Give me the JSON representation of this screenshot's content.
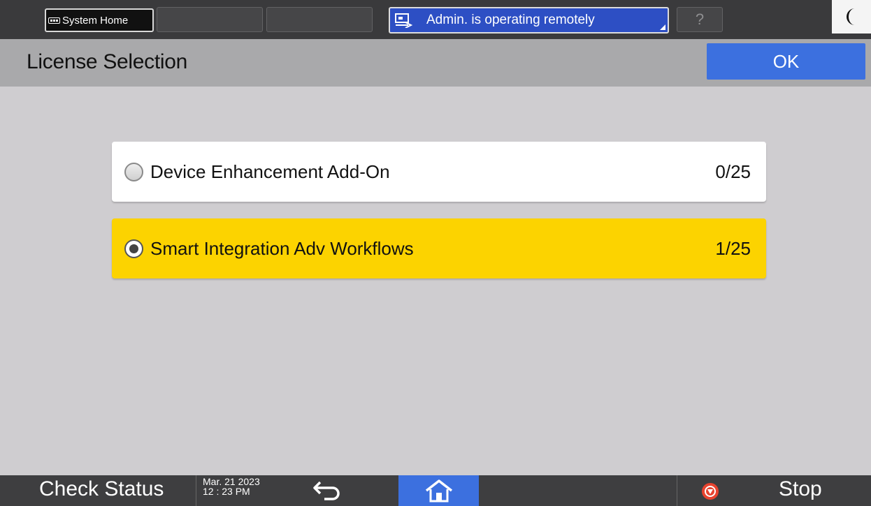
{
  "topbar": {
    "system_home_label": "System Home",
    "remote_status": "Admin. is operating remotely",
    "help_label": "?"
  },
  "header": {
    "title": "License Selection",
    "ok_label": "OK"
  },
  "options": [
    {
      "label": "Device Enhancement Add-On",
      "count": "0/25",
      "selected": false
    },
    {
      "label": "Smart Integration Adv Workflows",
      "count": "1/25",
      "selected": true
    }
  ],
  "bottombar": {
    "check_status_label": "Check Status",
    "date": "Mar. 21 2023",
    "time": "12 : 23 PM",
    "stop_label": "Stop"
  },
  "colors": {
    "accent": "#3c70df",
    "selected": "#fcd300",
    "remote": "#2d4fc4"
  },
  "icons": [
    "grid-icon",
    "remote-operation-icon",
    "moon-icon",
    "back-arrow-icon",
    "home-icon",
    "stop-icon"
  ]
}
